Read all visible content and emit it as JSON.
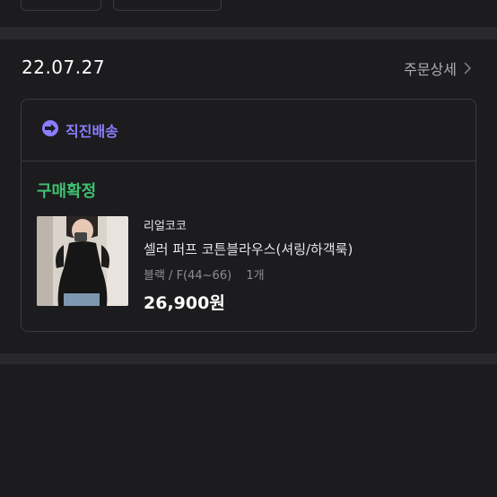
{
  "order": {
    "date": "22.07.27",
    "detail_label": "주문상세",
    "shipping_label": "직진배송",
    "status": "구매확정",
    "item": {
      "brand": "리얼코코",
      "name": "셀러 퍼프 코튼블라우스(셔링/하객룩)",
      "option": "블랙 / F(44~66)",
      "quantity": "1개",
      "price": "26,900원"
    }
  },
  "colors": {
    "background": "#1c1c1e",
    "divider": "#29292c",
    "shipping_accent": "#8b7dff",
    "status_green": "#3ec070"
  }
}
